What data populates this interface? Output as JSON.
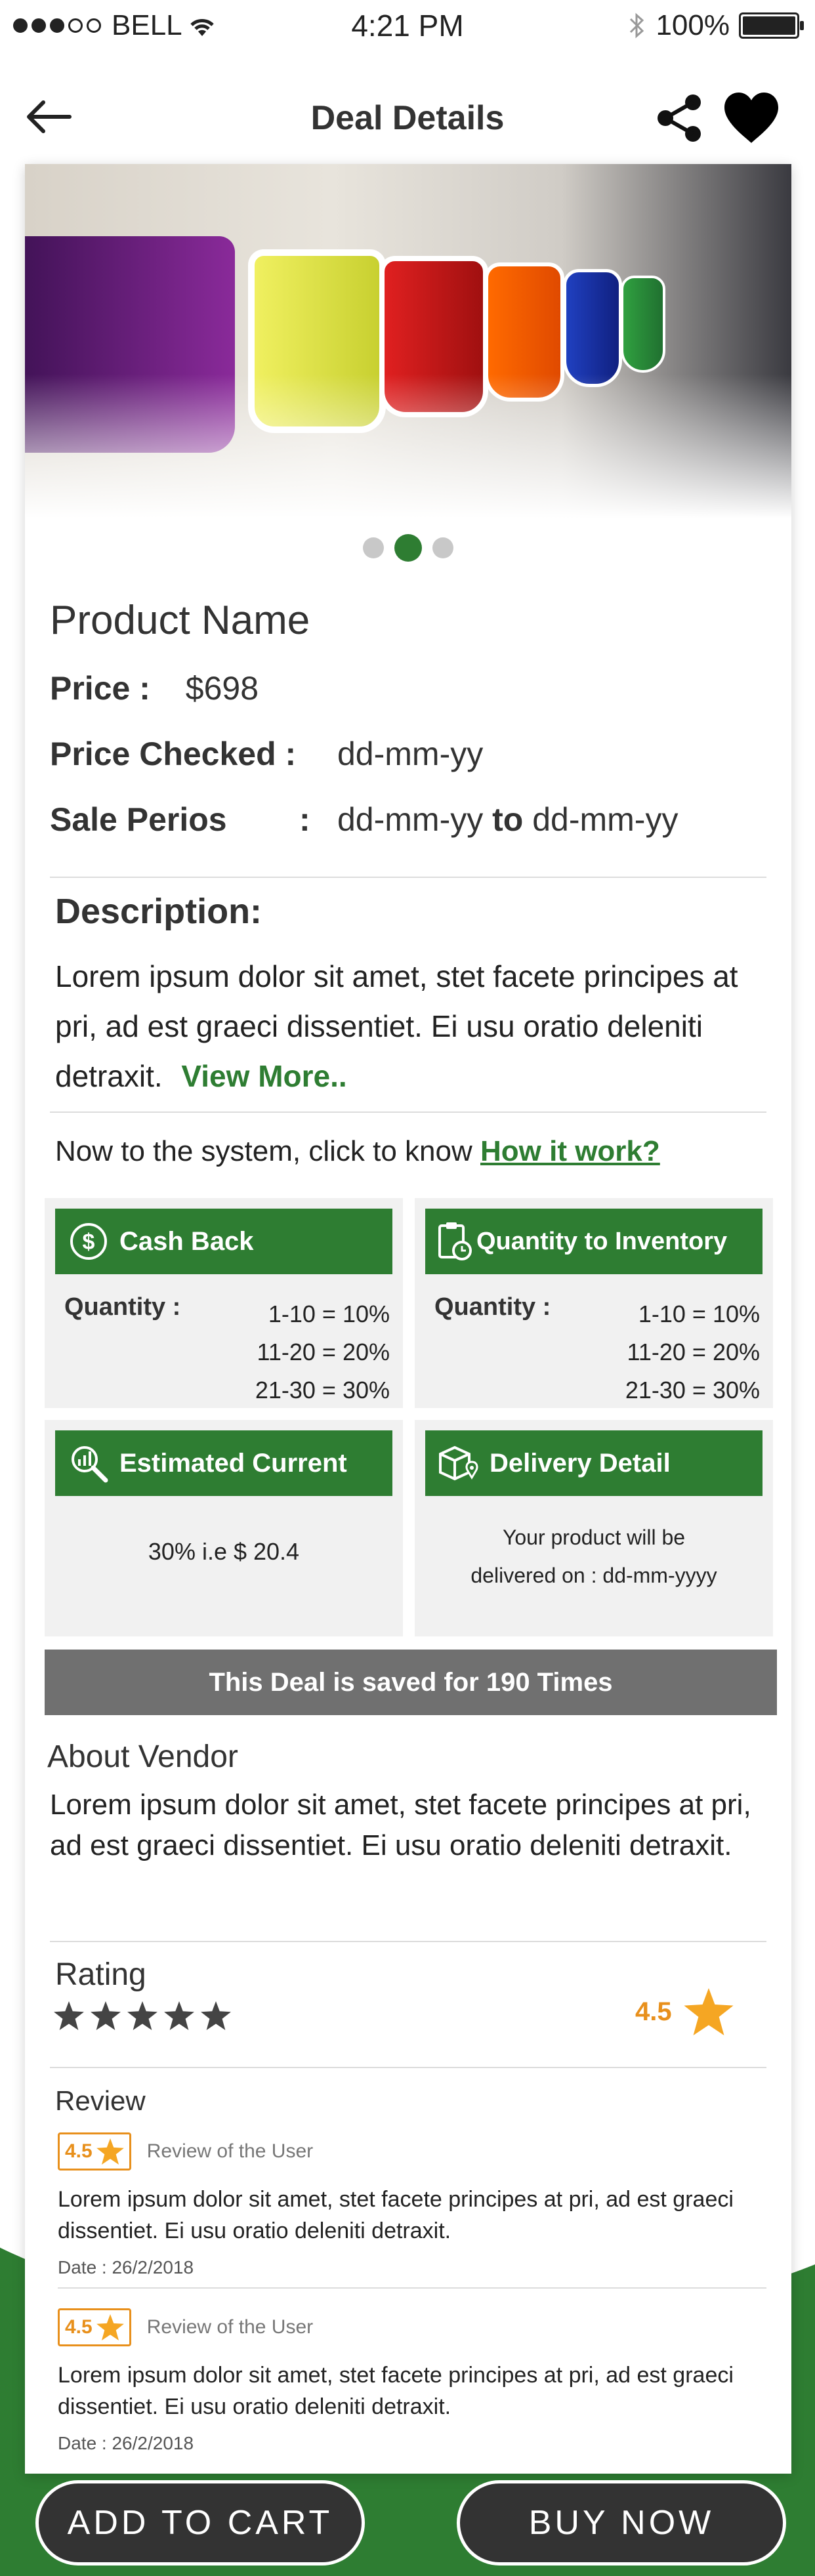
{
  "status": {
    "carrier": "BELL",
    "time": "4:21 PM",
    "battery": "100%"
  },
  "nav": {
    "title": "Deal Details"
  },
  "product": {
    "name": "Product Name",
    "price_label": "Price :",
    "price": "$698",
    "checked_label": "Price Checked :",
    "checked_value": "dd-mm-yy",
    "sale_label": "Sale Perios",
    "sale_colon": ":",
    "sale_from": "dd-mm-yy",
    "sale_to_word": "to",
    "sale_to": "dd-mm-yy"
  },
  "description": {
    "heading": "Description:",
    "text": "Lorem ipsum dolor sit amet, stet facete principes at pri, ad est graeci dissentiet. Ei usu oratio deleniti detraxit.",
    "view_more": "View More.."
  },
  "how": {
    "text": "Now to the system, click to know",
    "link": "How it work?"
  },
  "cashback": {
    "title": "Cash Back",
    "qty_label": "Quantity :",
    "tiers": [
      "1-10 = 10%",
      "11-20 = 20%",
      "21-30 = 30%"
    ]
  },
  "inventory": {
    "title": "Quantity to Inventory",
    "qty_label": "Quantity :",
    "tiers": [
      "1-10 = 10%",
      "11-20 = 20%",
      "21-30 = 30%"
    ]
  },
  "estimated": {
    "title": "Estimated Current",
    "value": "30% i.e $ 20.4"
  },
  "delivery": {
    "title": "Delivery Detail",
    "line1": "Your product will be",
    "line2": "delivered on : dd-mm-yyyy"
  },
  "saved": "This Deal is saved for 190 Times",
  "vendor": {
    "heading": "About Vendor",
    "text": "Lorem ipsum dolor sit amet, stet facete principes at pri, ad est graeci dissentiet. Ei usu oratio deleniti detraxit."
  },
  "rating": {
    "heading": "Rating",
    "value": "4.5",
    "stars": 5
  },
  "reviews": {
    "heading": "Review",
    "items": [
      {
        "score": "4.5",
        "who": "Review of the User",
        "text": "Lorem ipsum dolor sit amet, stet facete principes at pri, ad est graeci dissentiet. Ei usu oratio deleniti detraxit.",
        "date": "Date : 26/2/2018"
      },
      {
        "score": "4.5",
        "who": "Review of the User",
        "text": "Lorem ipsum dolor sit amet, stet facete principes at pri, ad est graeci dissentiet. Ei usu oratio deleniti detraxit.",
        "date": "Date : 26/2/2018"
      }
    ]
  },
  "actions": {
    "add_to_cart": "ADD TO CART",
    "buy_now": "BUY NOW"
  },
  "colors": {
    "accent": "#2e7d32",
    "star": "#f5a623",
    "rating_text": "#e8901c",
    "button": "#333333"
  }
}
